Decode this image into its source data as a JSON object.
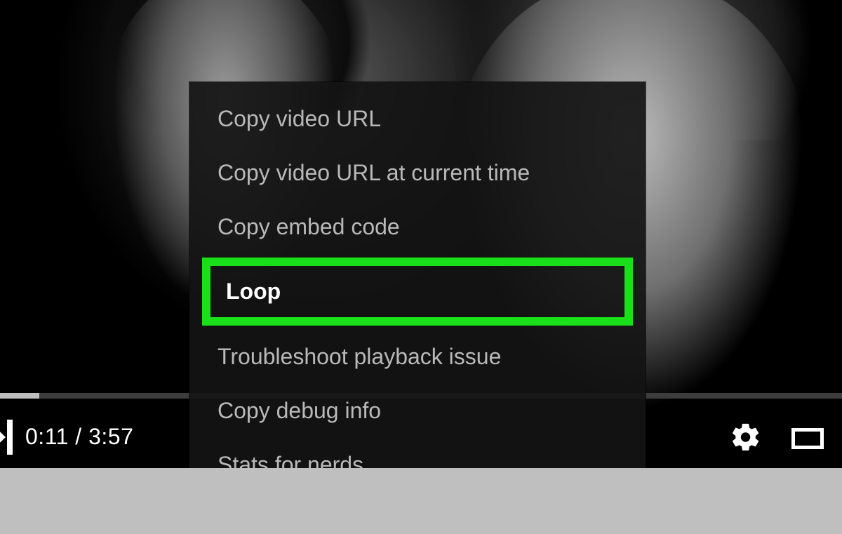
{
  "player": {
    "time_display": "0:11 / 3:57",
    "progress_fraction": 0.046
  },
  "context_menu": {
    "items": [
      {
        "label": "Copy video URL"
      },
      {
        "label": "Copy video URL at current time"
      },
      {
        "label": "Copy embed code"
      },
      {
        "label": "Loop"
      },
      {
        "label": "Troubleshoot playback issue"
      },
      {
        "label": "Copy debug info"
      },
      {
        "label": "Stats for nerds"
      }
    ],
    "highlight_index": 3,
    "highlight_color": "#19e019"
  }
}
